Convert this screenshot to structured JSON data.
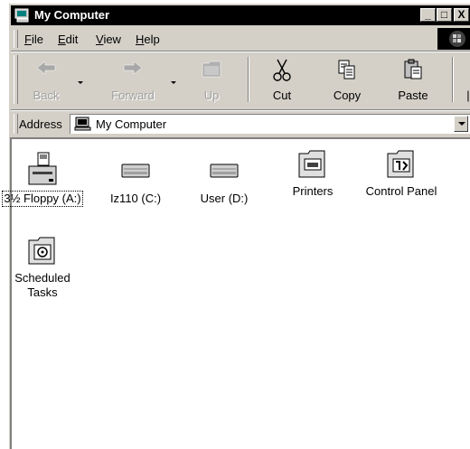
{
  "window": {
    "title": "My Computer",
    "controls": {
      "minimize": "_",
      "maximize": "□",
      "close": "X"
    }
  },
  "menubar": {
    "items": [
      {
        "key": "F",
        "rest": "ile"
      },
      {
        "key": "E",
        "rest": "dit"
      },
      {
        "key": "V",
        "rest": "iew"
      },
      {
        "key": "H",
        "rest": "elp"
      }
    ]
  },
  "toolbar": {
    "back": "Back",
    "forward": "Forward",
    "up": "Up",
    "cut": "Cut",
    "copy": "Copy",
    "paste": "Paste"
  },
  "address": {
    "label": "Address",
    "value": "My Computer"
  },
  "items": [
    {
      "label": "3½ Floppy (A:)",
      "icon": "floppy-drive-icon"
    },
    {
      "label": "Iz110 (C:)",
      "icon": "hard-drive-icon"
    },
    {
      "label": "User (D:)",
      "icon": "hard-drive-icon"
    },
    {
      "label": "Printers",
      "icon": "printers-folder-icon"
    },
    {
      "label": "Control Panel",
      "icon": "control-panel-icon"
    },
    {
      "label_line1": "Scheduled",
      "label_line2": "Tasks",
      "icon": "scheduled-tasks-icon"
    }
  ]
}
